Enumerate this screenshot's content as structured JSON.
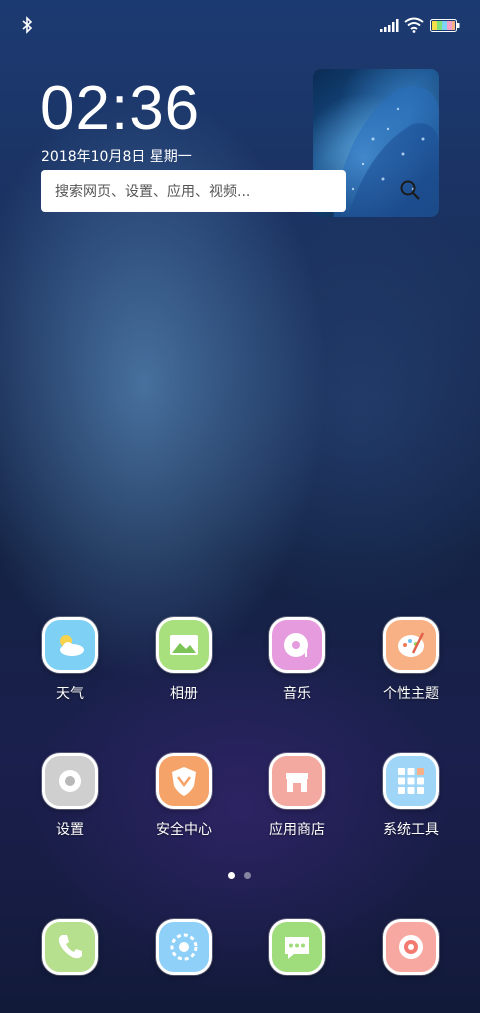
{
  "status_bar": {
    "icons": [
      "bluetooth-icon",
      "signal-icon",
      "wifi-icon",
      "battery-icon"
    ]
  },
  "clock": {
    "time": "02:36",
    "date": "2018年10月8日 星期一"
  },
  "search": {
    "placeholder": "搜索网页、设置、应用、视频..."
  },
  "apps_row1": [
    {
      "label": "天气",
      "icon": "weather-icon",
      "color": "#7fd0f5"
    },
    {
      "label": "相册",
      "icon": "gallery-icon",
      "color": "#a8e07e"
    },
    {
      "label": "音乐",
      "icon": "music-icon",
      "color": "#e59bde"
    },
    {
      "label": "个性主题",
      "icon": "theme-icon",
      "color": "#f7b184"
    }
  ],
  "apps_row2": [
    {
      "label": "设置",
      "icon": "settings-icon",
      "color": "#cfcfcf"
    },
    {
      "label": "安全中心",
      "icon": "security-icon",
      "color": "#f6a36a"
    },
    {
      "label": "应用商店",
      "icon": "app-store-icon",
      "color": "#f3a8a0"
    },
    {
      "label": "系统工具",
      "icon": "system-tools-icon",
      "color": "#9fd6f7"
    }
  ],
  "dock": [
    {
      "icon": "phone-icon",
      "color": "#b6df8e"
    },
    {
      "icon": "browser-icon",
      "color": "#8fd0f8"
    },
    {
      "icon": "messages-icon",
      "color": "#9fdc7c"
    },
    {
      "icon": "camera-icon",
      "color": "#f7a8a0"
    }
  ],
  "page_indicator": {
    "pages": 2,
    "current": 1
  }
}
